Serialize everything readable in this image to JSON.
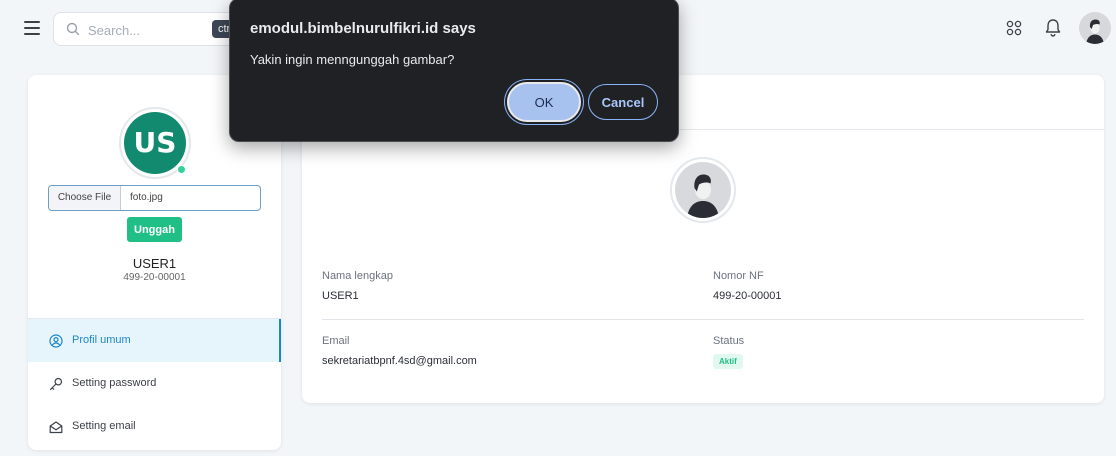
{
  "topbar": {
    "search_placeholder": "Search...",
    "search_shortcut": "ctrl"
  },
  "dialog": {
    "title": "emodul.bimbelnurulfikri.id says",
    "message": "Yakin ingin menngunggah gambar?",
    "ok_label": "OK",
    "cancel_label": "Cancel"
  },
  "left": {
    "avatar_initials": "US",
    "file_button_label": "Choose File",
    "file_name": "foto.jpg",
    "upload_label": "Unggah",
    "user_name": "USER1",
    "user_id": "499-20-00001",
    "menu": [
      {
        "label": "Profil umum",
        "icon": "user-circle-icon",
        "active": true
      },
      {
        "label": "Setting password",
        "icon": "key-icon",
        "active": false
      },
      {
        "label": "Setting email",
        "icon": "mail-open-icon",
        "active": false
      }
    ]
  },
  "profile": {
    "fields": {
      "name_label": "Nama lengkap",
      "name_value": "USER1",
      "nf_label": "Nomor NF",
      "nf_value": "499-20-00001",
      "email_label": "Email",
      "email_value": "sekretariatbpnf.4sd@gmail.com",
      "status_label": "Status",
      "status_value": "Aktif"
    }
  },
  "colors": {
    "avatar_bg": "#128a70",
    "primary_green": "#1fbf86",
    "active_blue": "#1c87c9",
    "dialog_bg": "#202124"
  }
}
